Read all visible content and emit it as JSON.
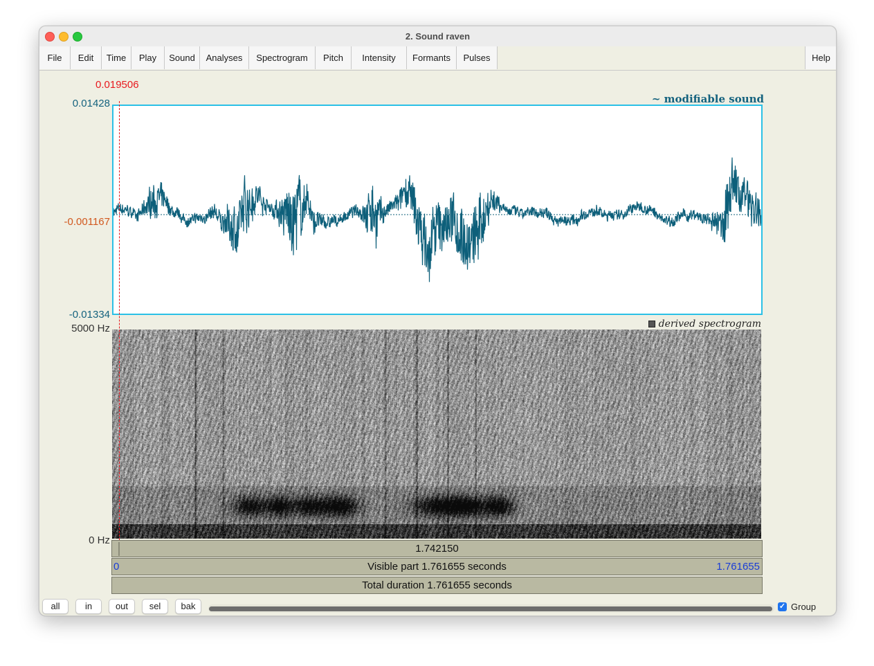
{
  "window": {
    "title": "2. Sound raven"
  },
  "menu": [
    "File",
    "Edit",
    "Time",
    "Play",
    "Sound",
    "Analyses",
    "Spectrogram",
    "Pitch",
    "Intensity",
    "Formants",
    "Pulses"
  ],
  "help": "Help",
  "cursor": {
    "time": "0.019506"
  },
  "waveform": {
    "title": "~ modifiable sound",
    "y_max": "0.01428",
    "y_mid": "-0.001167",
    "y_min": "-0.01334",
    "colors": {
      "line": "#0d5f7a",
      "border": "#2ac0e6"
    }
  },
  "spectrogram": {
    "title": "derived spectrogram",
    "f_max": "5000 Hz",
    "f_min": "0 Hz"
  },
  "bars": {
    "selection": "1.742150",
    "visible_left": "0",
    "visible_label": "Visible part 1.761655 seconds",
    "visible_right": "1.761655",
    "total": "Total duration 1.761655 seconds"
  },
  "buttons": {
    "all": "all",
    "in": "in",
    "out": "out",
    "sel": "sel",
    "bak": "bak"
  },
  "group": {
    "label": "Group",
    "checked": true
  }
}
